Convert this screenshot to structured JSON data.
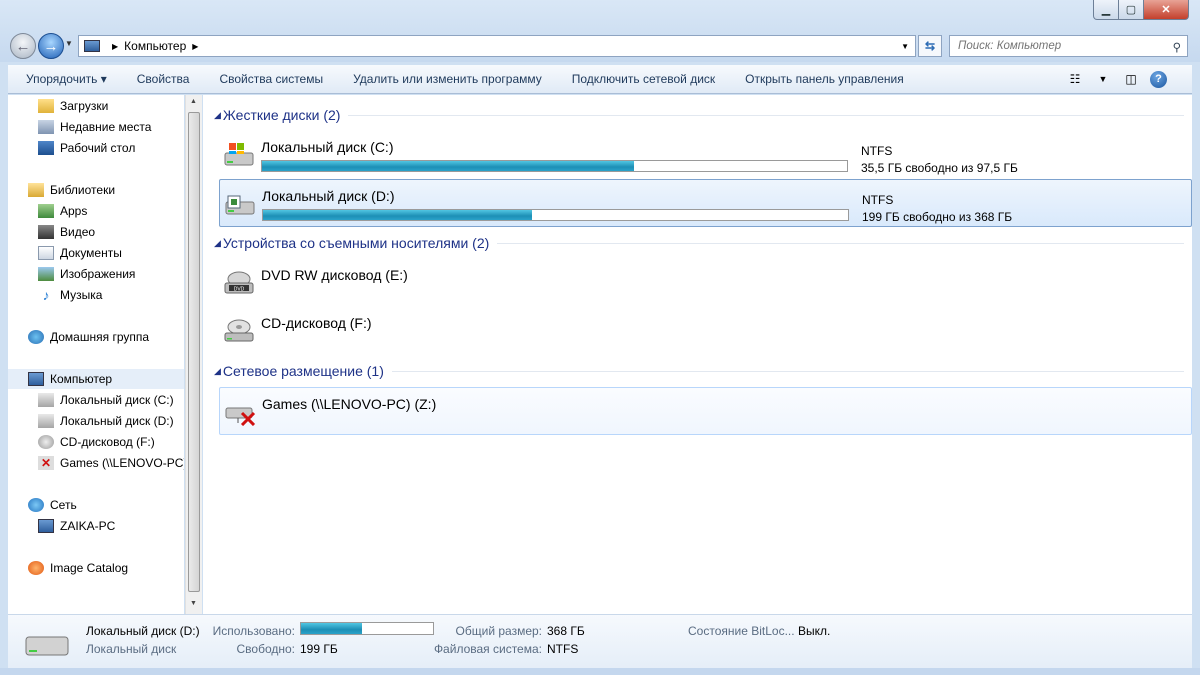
{
  "window": {
    "minimize_icon": "minimize-icon",
    "maximize_icon": "maximize-icon",
    "close_icon": "close-icon"
  },
  "address": {
    "segment": "Компьютер"
  },
  "search": {
    "placeholder": "Поиск: Компьютер"
  },
  "toolbar": {
    "items": [
      "Упорядочить ▾",
      "Свойства",
      "Свойства системы",
      "Удалить или изменить программу",
      "Подключить сетевой диск",
      "Открыть панель управления"
    ]
  },
  "sidebar": {
    "items": [
      {
        "label": "Загрузки",
        "icon": "downloads-folder-icon"
      },
      {
        "label": "Недавние места",
        "icon": "recent-places-icon"
      },
      {
        "label": "Рабочий стол",
        "icon": "desktop-icon"
      },
      {
        "label": "Библиотеки",
        "icon": "libraries-icon"
      },
      {
        "label": "Apps",
        "icon": "apps-library-icon"
      },
      {
        "label": "Видео",
        "icon": "video-icon"
      },
      {
        "label": "Документы",
        "icon": "documents-icon"
      },
      {
        "label": "Изображения",
        "icon": "pictures-icon"
      },
      {
        "label": "Музыка",
        "icon": "music-icon"
      },
      {
        "label": "Домашняя группа",
        "icon": "homegroup-icon"
      },
      {
        "label": "Компьютер",
        "icon": "computer-icon"
      },
      {
        "label": "Локальный диск (C:)",
        "icon": "drive-c-icon"
      },
      {
        "label": "Локальный диск (D:)",
        "icon": "drive-d-icon"
      },
      {
        "label": "CD-дисковод (F:)",
        "icon": "cd-drive-icon"
      },
      {
        "label": "Games (\\\\LENOVO-PC)",
        "icon": "network-drive-disconnected-icon"
      },
      {
        "label": "Сеть",
        "icon": "network-icon"
      },
      {
        "label": "ZAIKA-PC",
        "icon": "computer-icon"
      },
      {
        "label": "Image Catalog",
        "icon": "image-catalog-icon"
      }
    ]
  },
  "groups": {
    "hdd": {
      "title": "Жесткие диски (2)"
    },
    "removable": {
      "title": "Устройства со съемными носителями (2)"
    },
    "network": {
      "title": "Сетевое размещение (1)"
    }
  },
  "drives": [
    {
      "name": "Локальный диск (C:)",
      "fs": "NTFS",
      "free": "35,5 ГБ свободно из 97,5 ГБ",
      "used_fraction": 0.636
    },
    {
      "name": "Локальный диск (D:)",
      "fs": "NTFS",
      "free": "199 ГБ свободно из 368 ГБ",
      "used_fraction": 0.459
    },
    {
      "name": "DVD RW дисковод (E:)"
    },
    {
      "name": "CD-дисковод (F:)"
    },
    {
      "name": "Games (\\\\LENOVO-PC) (Z:)"
    }
  ],
  "details": {
    "name": "Локальный диск (D:)",
    "type": "Локальный диск",
    "used_label": "Использовано:",
    "used_fraction": 0.459,
    "free_label": "Свободно:",
    "free_value": "199 ГБ",
    "total_label": "Общий размер:",
    "total_value": "368 ГБ",
    "fs_label": "Файловая система:",
    "fs_value": "NTFS",
    "bitlocker_label": "Состояние BitLoc...",
    "bitlocker_value": "Выкл."
  }
}
